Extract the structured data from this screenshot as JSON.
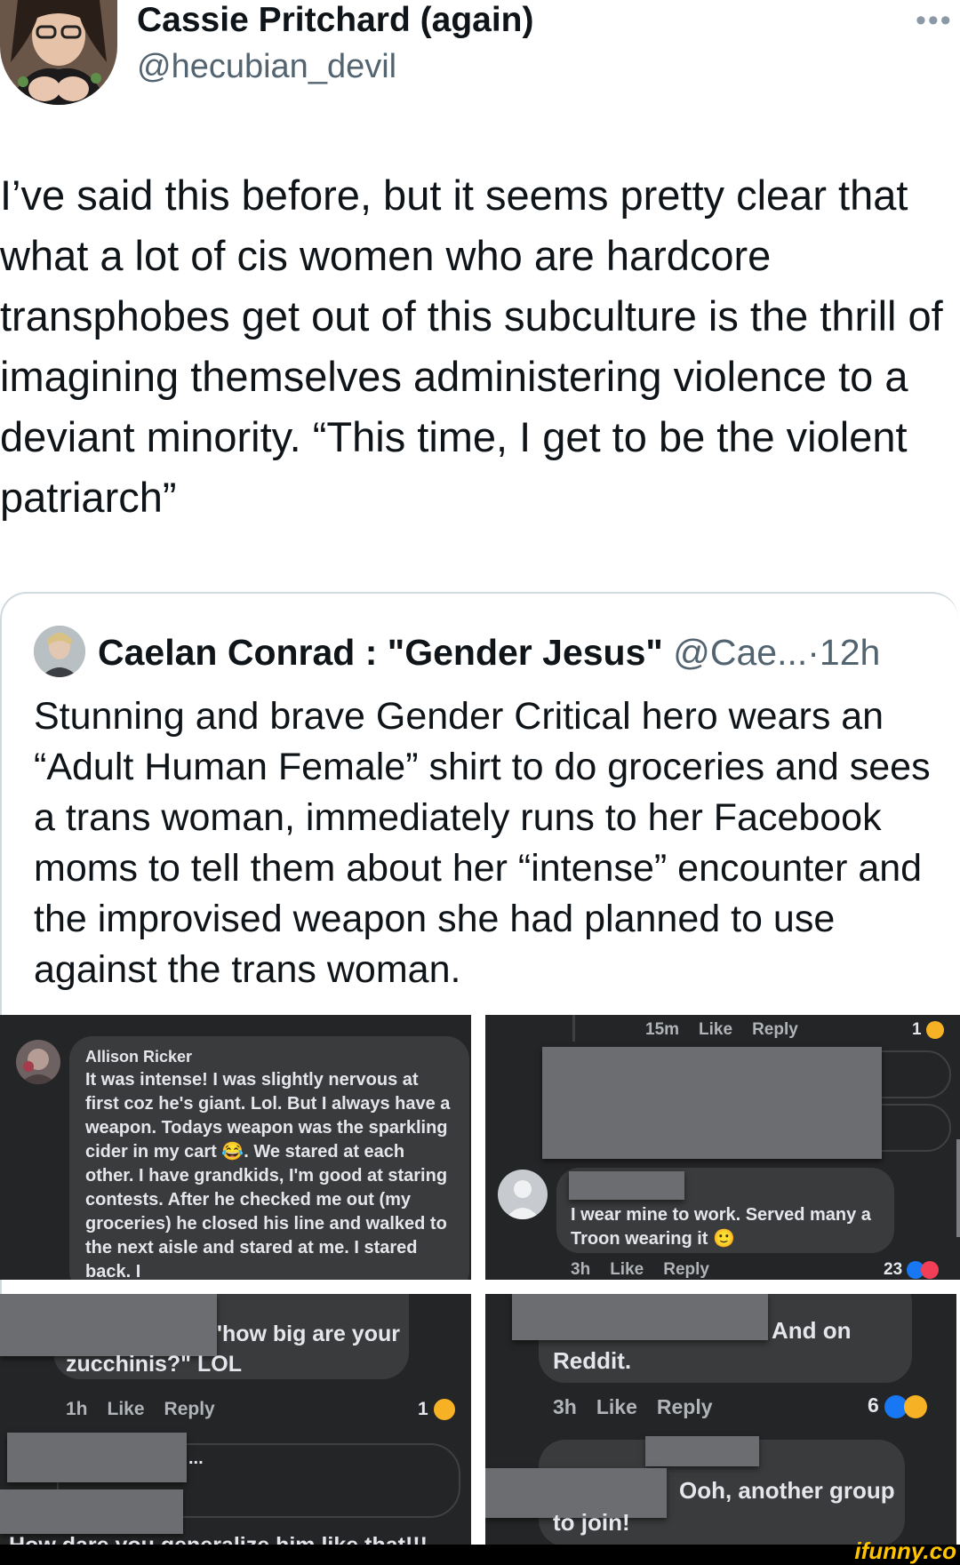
{
  "tweet": {
    "author_name": "Cassie Pritchard (again)",
    "author_handle": "@hecubian_devil",
    "more_icon": "more-icon",
    "text": "I’ve said this before, but it seems pretty clear that what a lot of cis women who are hardcore transphobes get out of this subculture is the thrill of imagining themselves administering violence to a deviant minority. “This time, I get to be the violent patriarch”"
  },
  "quote": {
    "author_name": "Caelan Conrad : \"Gender Jesus\"",
    "author_handle": "@Cae...",
    "separator": "·",
    "time": "12h",
    "text": "Stunning and brave Gender Critical hero wears an “Adult Human Female” shirt to do groceries and sees a trans woman, immediately runs to her Facebook moms to tell them about her “intense” encounter and the improvised weapon she had planned to use against the trans woman."
  },
  "panel1": {
    "commenter": "Allison Ricker",
    "comment": "It was intense! I was slightly nervous at first coz he's giant. Lol. But I always have a weapon. Todays weapon was the sparkling cider in my cart 😂. We stared at each other. I have grandkids, I'm good at staring contests. After he checked me out (my groceries) he closed his line and walked to the next aisle and stared at me. I stared back. I"
  },
  "panel2": {
    "top_time": "15m",
    "top_like": "Like",
    "top_reply": "Reply",
    "top_count": "1",
    "comment": "I wear mine to work. Served many a Troon wearing it 🙂",
    "time": "3h",
    "like": "Like",
    "reply": "Reply",
    "count": "23"
  },
  "panel3": {
    "text_line1": "'how big are your",
    "text_line2": "zucchinis?\" LOL",
    "time": "1h",
    "like": "Like",
    "reply": "Reply",
    "count": "1",
    "ellipsis": "...",
    "cut_text": "How dare you generalize him like that!!!"
  },
  "panel4": {
    "text_line1": "And on",
    "text_line2": "Reddit.",
    "time": "3h",
    "like": "Like",
    "reply": "Reply",
    "count": "6",
    "text2_line1": "Ooh, another group",
    "text2_line2": "to join!"
  },
  "watermark": "ifunny.co"
}
